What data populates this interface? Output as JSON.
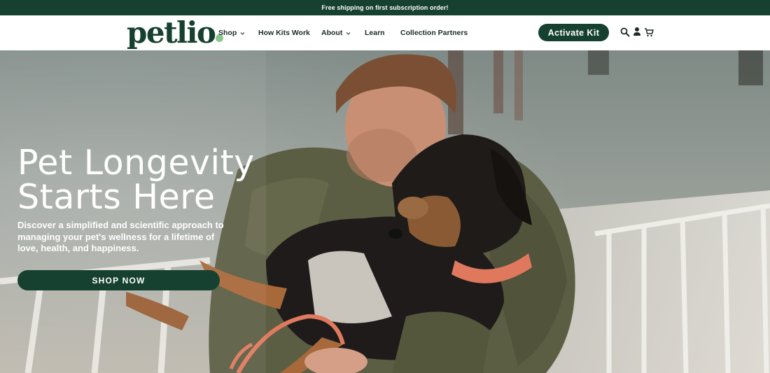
{
  "announcement": {
    "text": "Free shipping on first subscription order!"
  },
  "brand": {
    "name": "petlio",
    "color": "#16402f",
    "accent": "#8cc58f"
  },
  "nav": {
    "shop": "Shop",
    "how_kits_work": "How Kits Work",
    "about": "About",
    "learn": "Learn",
    "collection_partners": "Collection Partners"
  },
  "header": {
    "activate_label": "Activate Kit",
    "icons": [
      "search-icon",
      "account-icon",
      "cart-icon"
    ]
  },
  "hero": {
    "title_line1": "Pet Longevity",
    "title_line2": "Starts Here",
    "subtitle": "Discover a simplified and scientific approach to managing your pet's wellness for a lifetime of love, health, and happiness.",
    "cta_label": "SHOP NOW",
    "image": "man-hugging-dog-photo"
  }
}
